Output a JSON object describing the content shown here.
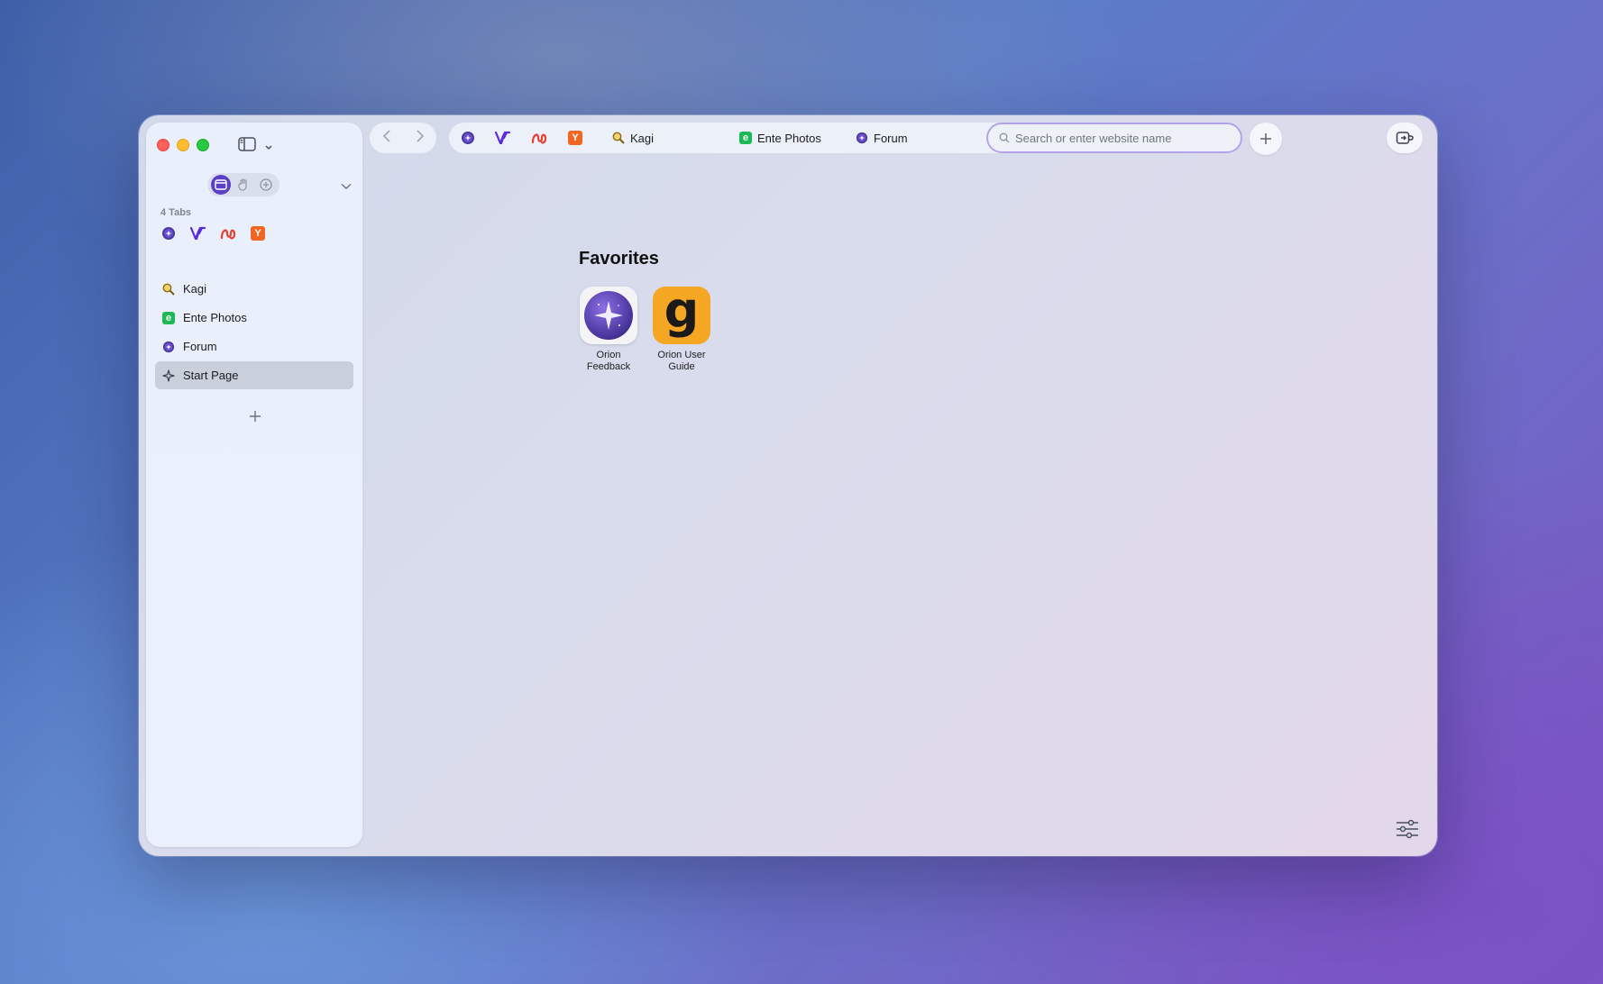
{
  "sidebar": {
    "tabs_count": "4 Tabs",
    "pinned": [
      {
        "icon": "forum-icon"
      },
      {
        "icon": "v-icon"
      },
      {
        "icon": "swirl-icon"
      },
      {
        "icon": "hn-icon",
        "letter": "Y"
      }
    ],
    "tabs": [
      {
        "label": "Kagi",
        "icon": "kagi-icon"
      },
      {
        "label": "Ente Photos",
        "icon": "ente-icon",
        "letter": "e"
      },
      {
        "label": "Forum",
        "icon": "forum-icon"
      },
      {
        "label": "Start Page",
        "icon": "sparkle-icon",
        "active": true
      }
    ]
  },
  "tabbar": {
    "tabs": [
      {
        "label": "Kagi",
        "icon": "kagi-icon"
      },
      {
        "label": "Ente Photos",
        "icon": "ente-icon",
        "letter": "e"
      },
      {
        "label": "Forum",
        "icon": "forum-icon"
      }
    ]
  },
  "address": {
    "placeholder": "Search or enter website name"
  },
  "start_page": {
    "title": "Favorites",
    "favorites": [
      {
        "label": "Orion Feedback",
        "icon": "orion-feedback-icon"
      },
      {
        "label": "Orion User Guide",
        "icon": "orion-guide-icon",
        "letter": "g"
      }
    ]
  },
  "colors": {
    "accent": "#5b3fc4",
    "hn": "#f26522",
    "ente": "#1db954",
    "kagi": "#f5b60d"
  }
}
